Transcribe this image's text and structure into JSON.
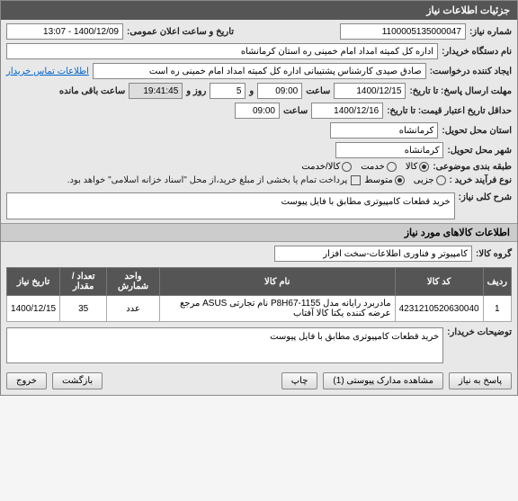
{
  "header": {
    "title": "جزئیات اطلاعات نیاز"
  },
  "top": {
    "need_number_label": "شماره نیاز:",
    "need_number": "1100005135000047",
    "announce_label": "تاریخ و ساعت اعلان عمومی:",
    "announce_value": "1400/12/09 - 13:07",
    "buyer_label": "نام دستگاه خریدار:",
    "buyer_value": "اداره کل کمیته امداد امام خمینی  ره  استان کرمانشاه",
    "creator_label": "ایجاد کننده درخواست:",
    "creator_value": "صادق  صیدی  کارشناس پشتیبانی  اداره کل کمیته امداد امام خمینی  ره  است",
    "contact_link": "اطلاعات تماس خریدار",
    "deadline_send_label": "مهلت ارسال پاسخ: تا تاریخ:",
    "deadline_date": "1400/12/15",
    "time_label": "ساعت",
    "deadline_time": "09:00",
    "days_and": "و",
    "days_value": "5",
    "days_label": "روز و",
    "remain_time": "19:41:45",
    "remain_label": "ساعت باقی مانده",
    "validity_label": "حداقل تاریخ اعتبار قیمت: تا تاریخ:",
    "validity_date": "1400/12/16",
    "validity_time": "09:00",
    "city_label": "استان محل تحویل:",
    "city_value": "کرمانشاه",
    "delivery_city_label": "شهر محل تحویل:",
    "delivery_city_value": "کرمانشاه",
    "subject_group_label": "طبقه بندی موضوعی:",
    "radio_kala": "کالا",
    "radio_khadamat": "خدمت",
    "radio_kala_khadamat": "کالا/خدمت",
    "process_label": "نوع فرآیند خرید :",
    "radio_jozi": "جزیی",
    "radio_motevasset": "متوسط",
    "payment_note": "پرداخت تمام یا بخشی از مبلغ خرید،از محل \"اسناد خزانه اسلامی\" خواهد بود."
  },
  "desc": {
    "title_label": "شرح کلی نیاز:",
    "title_value": "خرید قطعات کامپیوتری مطابق با فایل پیوست"
  },
  "goods_section": "اطلاعات کالاهای مورد نیاز",
  "goods_group": {
    "label": "گروه کالا:",
    "value": "کامپیوتر و فناوری اطلاعات-سخت افزار"
  },
  "table": {
    "headers": {
      "row": "ردیف",
      "code": "کد کالا",
      "name": "نام کالا",
      "unit": "واحد شمارش",
      "qty": "تعداد / مقدار",
      "date": "تاریخ نیاز"
    },
    "rows": [
      {
        "row": "1",
        "code": "4231210520630040",
        "name": "مادربرد رایانه مدل P8H67-1155 نام تجارتی ASUS مرجع عرضه کننده یکتا کالا آفتاب",
        "unit": "عدد",
        "qty": "35",
        "date": "1400/12/15"
      }
    ]
  },
  "buyer_notes": {
    "label": "توضیحات خریدار:",
    "value": "خرید قطعات کامپیوتری مطابق با فایل پیوست"
  },
  "buttons": {
    "reply": "پاسخ به نیاز",
    "attachments": "مشاهده مدارک پیوستی (1)",
    "print": "چاپ",
    "back": "بازگشت",
    "exit": "خروج"
  }
}
